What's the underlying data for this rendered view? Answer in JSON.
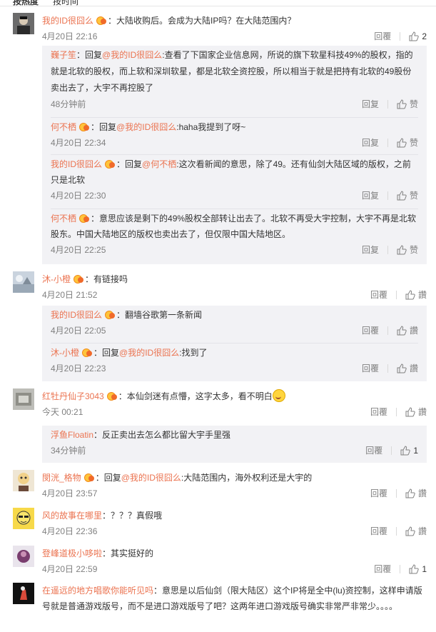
{
  "sort": {
    "hot": "按热度",
    "time": "按时间"
  },
  "ui": {
    "reply": "回覆",
    "reply_simplified": "回复",
    "like": "赞",
    "like_alt": "讚",
    "reply_prefix": "回复",
    "colon": "："
  },
  "colors": {
    "username": "#eb7350",
    "meta": "#808080",
    "reply_bg": "#f2f2f5",
    "badge": "#ffc43b"
  },
  "comments": [
    {
      "user": "我的ID很囧么",
      "text": "大陆收购后。会成为大陆IP吗？在大陆范围内？",
      "time": "4月20日 22:16",
      "like_count": "2",
      "replies": [
        {
          "user": "巍子笙",
          "at": "@我的ID很囧么",
          "text": ":查看了下国家企业信息网，所说的旗下软星科技49%的股权，指的就是北软的股权，而上软和深圳软星，都是北软全资控股，所以相当于就是把持有北软的49股份卖出去了，大宇不再控股了",
          "time": "48分钟前"
        },
        {
          "user": "何不栖",
          "at": "@我的ID很囧么",
          "text": ":haha我提到了呀~",
          "time": "4月20日 22:34"
        },
        {
          "user": "我的ID很囧么",
          "at": "@何不栖",
          "text": ":这次看新闻的意思，除了49。还有仙剑大陆区域的版权，之前只是北软",
          "time": "4月20日 22:30"
        },
        {
          "user": "何不栖",
          "text": "意思应该是剩下的49%股权全部转让出去了。北软不再受大宇控制，大宇不再是北软股东。中国大陆地区的版权也卖出去了，但仅限中国大陆地区。",
          "time": "4月20日 22:25"
        }
      ]
    },
    {
      "user": "沐-小橙",
      "text": "有链接吗",
      "time": "4月20日 21:52",
      "replies": [
        {
          "user": "我的ID很囧么",
          "text": "翻墙谷歌第一条新闻",
          "time": "4月20日 22:05"
        },
        {
          "user": "沐-小橙",
          "at": "@我的ID很囧么",
          "text": ":找到了",
          "time": "4月20日 22:23"
        }
      ]
    },
    {
      "user": "红牡丹仙子3043",
      "text": "本仙剑迷有点懵，这字太多，看不明白",
      "time": "今天 00:21",
      "replies": [
        {
          "user": "浮鱼Floatin",
          "text": "反正卖出去怎么都比留大宇手里强",
          "time": "34分钟前",
          "like_count": "1"
        }
      ]
    },
    {
      "user": "閔洸_格物",
      "at": "@我的ID很囧么",
      "text": ":大陆范围内，海外权利还是大宇的",
      "time": "4月20日 23:57"
    },
    {
      "user": "风的故事在哪里",
      "text": "？？？真假哦",
      "time": "4月20日 22:36"
    },
    {
      "user": "登峰道极小哆啦",
      "text": "其实挺好的",
      "time": "4月20日 22:59",
      "like_count": "1"
    },
    {
      "user": "在遥远的地方唱歌你能听见吗",
      "text": "意思是以后仙剑（限大陆区）这个IP将是全中(lu)资控制，这样申请版号就是普通游戏版号，而不是进口游戏版号了吧？这两年进口游戏版号确实非常严非常少。。。。"
    }
  ]
}
